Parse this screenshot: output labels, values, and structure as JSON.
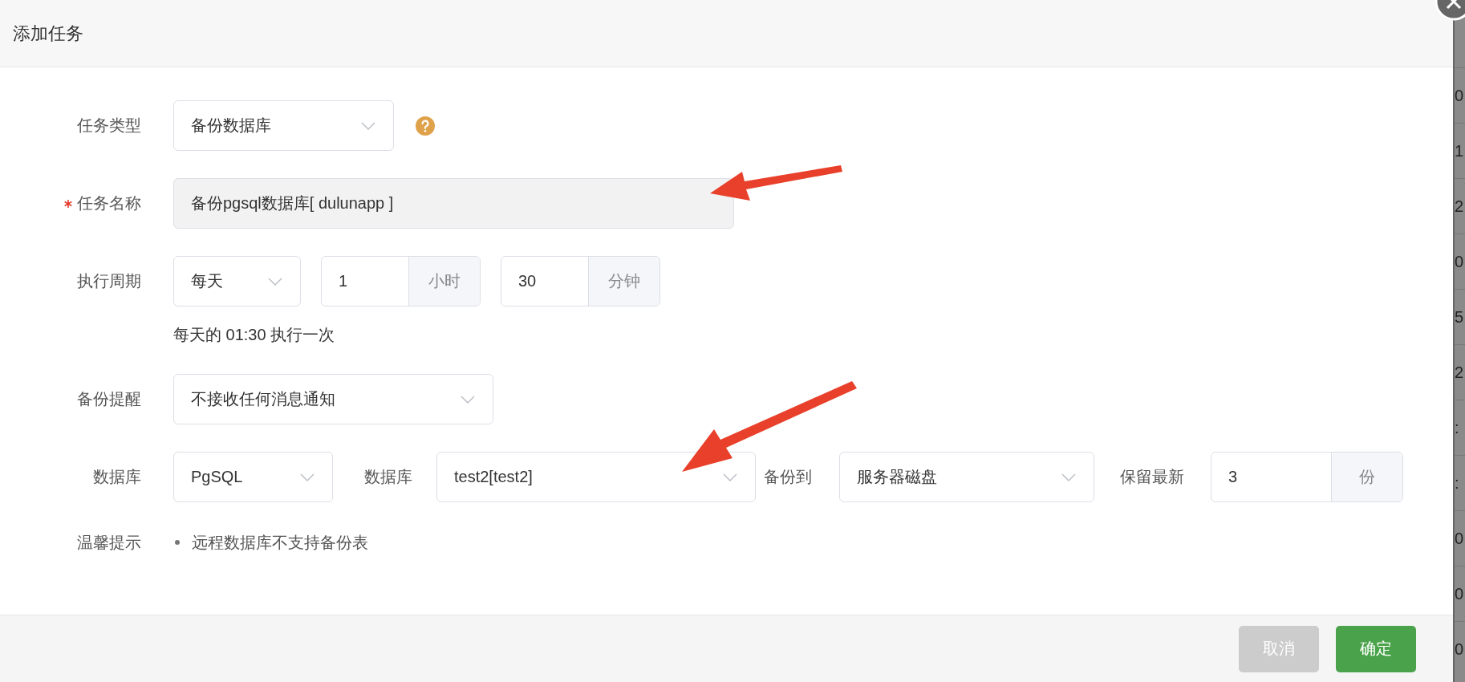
{
  "dialog": {
    "title": "添加任务"
  },
  "rows": [
    {
      "label": "任务类型",
      "required": false,
      "controls": [
        {
          "kind": "select",
          "value": "备份数据库"
        },
        {
          "kind": "help"
        }
      ]
    },
    {
      "label": "任务名称",
      "required": true,
      "controls": [
        {
          "kind": "input",
          "value": "备份pgsql数据库[ dulunapp ]",
          "disabled": true
        }
      ]
    },
    {
      "label": "执行周期",
      "required": false,
      "controls": [
        {
          "kind": "select",
          "value": "每天"
        },
        {
          "kind": "input_addon",
          "value": "1",
          "addon": "小时"
        },
        {
          "kind": "input_addon",
          "value": "30",
          "addon": "分钟"
        }
      ],
      "note": "每天的 01:30 执行一次"
    },
    {
      "label": "备份提醒",
      "required": false,
      "controls": [
        {
          "kind": "select",
          "value": "不接收任何消息通知"
        }
      ]
    },
    {
      "label": "数据库",
      "required": false,
      "controls": [
        {
          "kind": "select",
          "value": "PgSQL"
        },
        {
          "kind": "label",
          "text": "数据库"
        },
        {
          "kind": "select",
          "value": "test2[test2]"
        },
        {
          "kind": "label",
          "text": "备份到"
        },
        {
          "kind": "select",
          "value": "服务器磁盘"
        },
        {
          "kind": "label",
          "text": "保留最新"
        },
        {
          "kind": "input_addon",
          "value": "3",
          "addon": "份"
        }
      ]
    },
    {
      "label": "温馨提示",
      "required": false,
      "controls": [
        {
          "kind": "bullet",
          "text": "远程数据库不支持备份表"
        }
      ]
    }
  ],
  "buttons": [
    {
      "label": "取消",
      "kind": "secondary"
    },
    {
      "label": "确定",
      "kind": "primary"
    }
  ],
  "background_column": [
    "0",
    "1",
    "2",
    "0",
    "5",
    "2",
    ":",
    ":",
    "0",
    "0",
    "0"
  ]
}
